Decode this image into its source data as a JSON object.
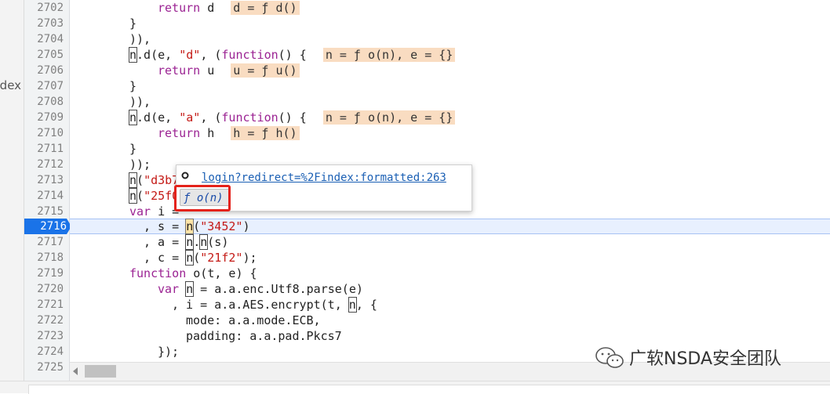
{
  "left_panel": {
    "tab_label": "index"
  },
  "editor": {
    "active_line": "2716",
    "line_numbers": [
      "2702",
      "2703",
      "2704",
      "2705",
      "2706",
      "2707",
      "2708",
      "2709",
      "2710",
      "2711",
      "2712",
      "2713",
      "2714",
      "2715",
      "2716",
      "2717",
      "2718",
      "2719",
      "2720",
      "2721",
      "2722",
      "2723",
      "2724",
      "2725"
    ]
  },
  "popup": {
    "location_link": "login?redirect=%2Findex:formatted:263",
    "function_label": "ƒ o(n)"
  },
  "watermark": {
    "text": "广软NSDA安全团队"
  },
  "colors": {
    "active_line": "#1a73e8",
    "highlight_box": "#e4221b",
    "inline_value_bg": "#f9dcc1"
  }
}
